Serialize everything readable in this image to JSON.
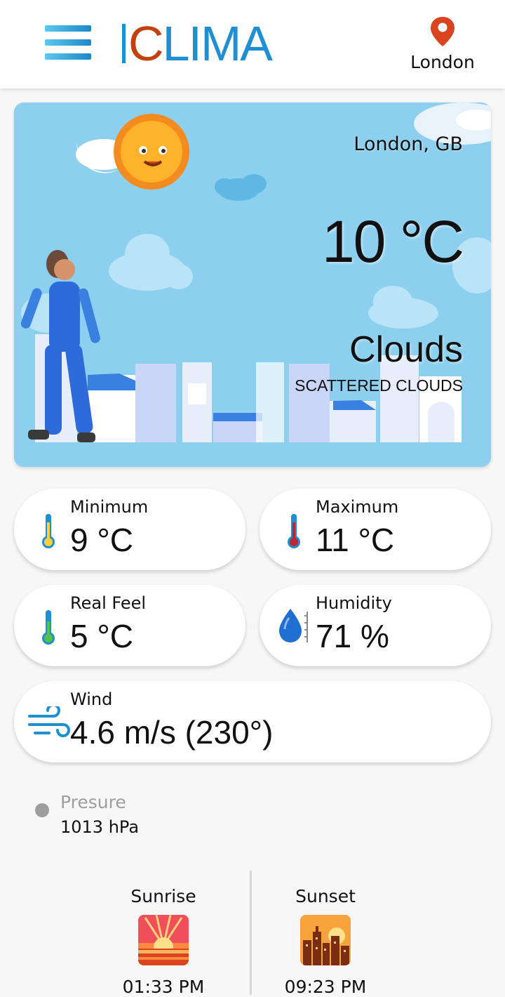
{
  "header": {
    "logo_prefix": "C",
    "logo_rest": "LIMA",
    "location": "London",
    "icons": {
      "menu": "hamburger-menu-icon",
      "location": "map-pin-icon"
    }
  },
  "hero": {
    "city": "London, GB",
    "temperature": "10 °C",
    "main": "Clouds",
    "description": "SCATTERED CLOUDS"
  },
  "cards": {
    "minimum": {
      "label": "Minimum",
      "value": "9 °C",
      "icon": "thermometer-icon"
    },
    "maximum": {
      "label": "Maximum",
      "value": "11 °C",
      "icon": "thermometer-icon"
    },
    "real_feel": {
      "label": "Real Feel",
      "value": "5 °C",
      "icon": "thermometer-icon"
    },
    "humidity": {
      "label": "Humidity",
      "value": "71 %",
      "icon": "water-drop-icon"
    },
    "wind": {
      "label": "Wind",
      "value": "4.6 m/s (230°)",
      "icon": "wind-icon"
    }
  },
  "pressure": {
    "label": "Presure",
    "value": "1013 hPa"
  },
  "sun": {
    "sunrise_label": "Sunrise",
    "sunrise_time": "01:33 PM",
    "sunset_label": "Sunset",
    "sunset_time": "09:23 PM"
  },
  "colors": {
    "accent": "#1e8fd1",
    "brand_c": "#c2410c",
    "hero_bg": "#8ccfee",
    "pin": "#d9431e"
  }
}
